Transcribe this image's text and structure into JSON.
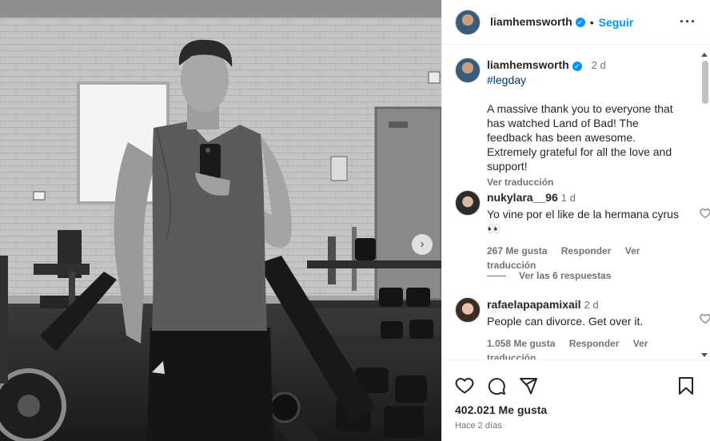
{
  "post": {
    "username": "liamhemsworth",
    "follow_label": "Seguir",
    "caption_time": "2 d",
    "hashtag": "#legday",
    "caption_text": "A massive thank you to everyone that has watched Land of Bad! The feedback has been awesome. Extremely grateful for all the love and support!",
    "translate_label": "Ver traducción",
    "likes": "402.021 Me gusta",
    "posted_ago": "Hace 2 días"
  },
  "comments": [
    {
      "username": "nukylara__96",
      "time": "1 d",
      "text": "Yo vine por el like de la hermana cyrus 👀",
      "likes": "267 Me gusta",
      "reply_label": "Responder",
      "translate_label": "Ver traducción",
      "view_replies": "Ver las 6 respuestas"
    },
    {
      "username": "rafaelapapamixail",
      "time": "2 d",
      "text": "People can divorce. Get over it.",
      "likes": "1.058 Me gusta",
      "reply_label": "Responder",
      "translate_label": "Ver traducción"
    }
  ],
  "colors": {
    "accent": "#0095f6",
    "text": "#262626",
    "muted": "#737373"
  },
  "icons": [
    "more-options-icon",
    "verified-badge-icon",
    "heart-icon",
    "comment-icon",
    "share-icon",
    "bookmark-icon",
    "chevron-right-icon"
  ]
}
